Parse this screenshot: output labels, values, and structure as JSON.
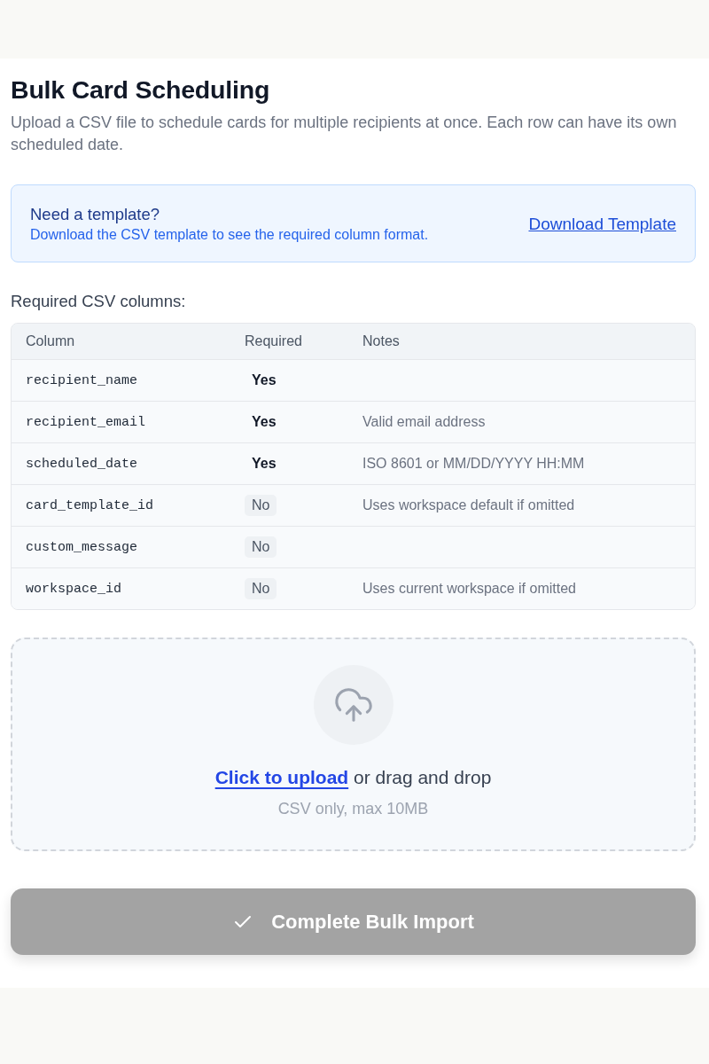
{
  "page": {
    "title": "Bulk Card Scheduling",
    "description": "Upload a CSV file to schedule cards for multiple recipients at once. Each row can have its own scheduled date."
  },
  "template_notice": {
    "title": "Need a template?",
    "text": "Download the CSV template to see the required column format.",
    "link": "Download Template"
  },
  "columns_section": {
    "heading": "Required CSV columns:",
    "table": {
      "columns": [
        "Column",
        "Required",
        "Notes"
      ],
      "rows": [
        {
          "column": "recipient_name",
          "required": true,
          "required_label": "Yes"
        },
        {
          "column": "recipient_email",
          "required": true,
          "required_label": "Yes",
          "notes": "Valid email address"
        },
        {
          "column": "scheduled_date",
          "required": true,
          "required_label": "Yes",
          "notes": "ISO 8601 or MM/DD/YYYY HH:MM"
        },
        {
          "column": "card_template_id",
          "required": false,
          "required_label": "No",
          "notes": "Uses workspace default if omitted"
        },
        {
          "column": "custom_message",
          "required": false,
          "required_label": "No"
        },
        {
          "column": "workspace_id",
          "required": false,
          "required_label": "No",
          "notes": "Uses current workspace if omitted"
        }
      ]
    }
  },
  "upload": {
    "link": "Click to upload",
    "text": "or drag and drop",
    "hint": "CSV only, max 10MB"
  },
  "submit_button": {
    "label": "Complete Bulk Import",
    "disabled": true
  }
}
